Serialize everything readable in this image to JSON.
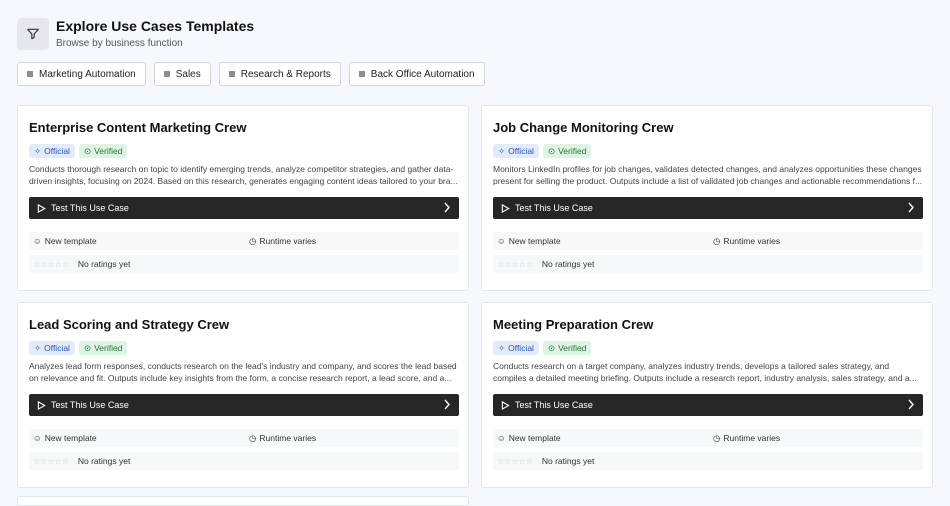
{
  "header": {
    "title": "Explore Use Cases Templates",
    "subtitle": "Browse by business function",
    "icon": "filter-icon"
  },
  "filters": [
    {
      "label": "Marketing Automation"
    },
    {
      "label": "Sales"
    },
    {
      "label": "Research & Reports"
    },
    {
      "label": "Back Office Automation"
    }
  ],
  "badges": {
    "official": "Official",
    "verified": "Verified"
  },
  "cards": [
    {
      "title": "Enterprise Content Marketing Crew",
      "desc1": "Conducts thorough research on topic to identify emerging trends, analyze competitor strategies, and gather data-",
      "desc2": "driven insights, focusing on 2024. Based on this research, generates engaging content ideas tailored to your bra...",
      "button": "Test This Use Case",
      "template": "New template",
      "runtime": "Runtime varies",
      "ratings": "No ratings yet"
    },
    {
      "title": "Job Change Monitoring Crew",
      "desc1": "Monitors LinkedIn profiles for job changes, validates detected changes, and analyzes opportunities these changes",
      "desc2": "present for selling the product. Outputs include a list of validated job changes and actionable recommendations f...",
      "button": "Test This Use Case",
      "template": "New template",
      "runtime": "Runtime varies",
      "ratings": "No ratings yet"
    },
    {
      "title": "Lead Scoring and Strategy Crew",
      "desc1": "Analyzes lead form responses, conducts research on the lead's industry and company, and scores the lead based",
      "desc2": "on relevance and fit. Outputs include key insights from the form, a concise research report, a lead score, and a...",
      "button": "Test This Use Case",
      "template": "New template",
      "runtime": "Runtime varies",
      "ratings": "No ratings yet"
    },
    {
      "title": "Meeting Preparation Crew",
      "desc1": "Conducts research on a target company, analyzes industry trends, develops a tailored sales strategy, and",
      "desc2": "compiles a detailed meeting briefing. Outputs include a research report, industry analysis, sales strategy, and a...",
      "button": "Test This Use Case",
      "template": "New template",
      "runtime": "Runtime varies",
      "ratings": "No ratings yet"
    }
  ],
  "colors": {
    "background": "#f5f8fc",
    "button": "#262626",
    "official": "#2a56b8",
    "verified": "#1f7a3a"
  }
}
